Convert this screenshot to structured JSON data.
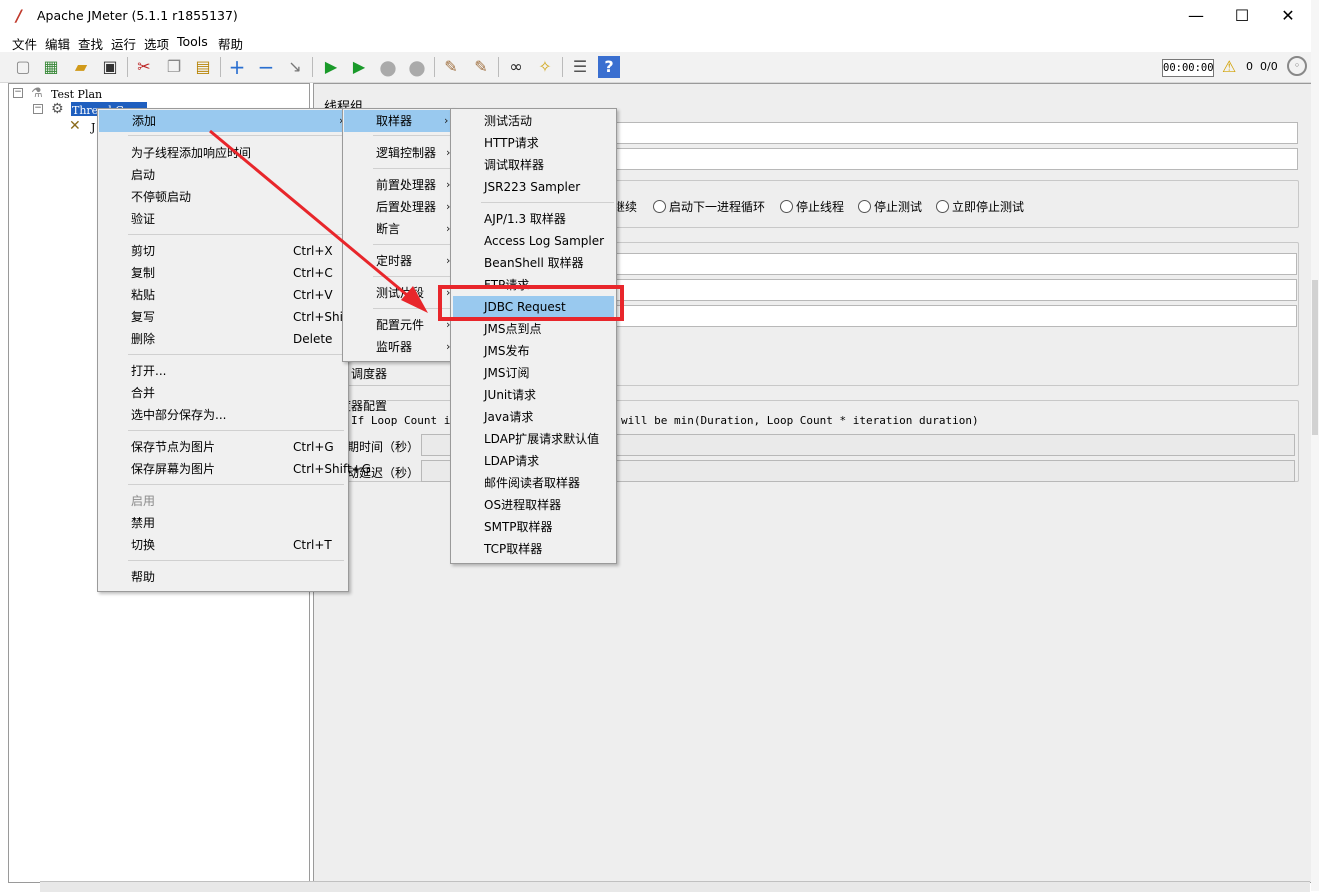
{
  "window": {
    "title": "Apache JMeter (5.1.1 r1855137)",
    "controls": {
      "minimize": "—",
      "maximize": "☐",
      "close": "✕"
    }
  },
  "menubar": [
    "文件",
    "编辑",
    "查找",
    "运行",
    "选项",
    "Tools",
    "帮助"
  ],
  "toolbar": {
    "timer": "00:00:00",
    "warning_count": "0",
    "thread_ratio": "0/0"
  },
  "tree": {
    "test_plan": "Test Plan",
    "thread_group": "Thread G",
    "child_partial": "J"
  },
  "right_panel": {
    "title": "线程组",
    "error_options": [
      "继续",
      "启动下一进程循环",
      "停止线程",
      "停止测试",
      "立即停止测试"
    ],
    "scheduler_checkbox": "调度器",
    "scheduler_section": "度器配置",
    "loop_note_left": "If Loop Count is",
    "loop_note_right": "will be min(Duration, Loop Count * iteration duration)",
    "duration_label": "期时间（秒）",
    "delay_label": "动延迟（秒）"
  },
  "context_menu": {
    "add": "添加",
    "items": [
      {
        "label": "为子线程添加响应时间",
        "shortcut": ""
      },
      {
        "label": "启动",
        "shortcut": ""
      },
      {
        "label": "不停顿启动",
        "shortcut": ""
      },
      {
        "label": "验证",
        "shortcut": ""
      },
      {
        "label": "剪切",
        "shortcut": "Ctrl+X"
      },
      {
        "label": "复制",
        "shortcut": "Ctrl+C"
      },
      {
        "label": "粘贴",
        "shortcut": "Ctrl+V"
      },
      {
        "label": "复写",
        "shortcut": "Ctrl+Shift+C"
      },
      {
        "label": "删除",
        "shortcut": "Delete"
      },
      {
        "label": "打开...",
        "shortcut": ""
      },
      {
        "label": "合并",
        "shortcut": ""
      },
      {
        "label": "选中部分保存为...",
        "shortcut": ""
      },
      {
        "label": "保存节点为图片",
        "shortcut": "Ctrl+G"
      },
      {
        "label": "保存屏幕为图片",
        "shortcut": "Ctrl+Shift+G"
      },
      {
        "label": "启用",
        "shortcut": ""
      },
      {
        "label": "禁用",
        "shortcut": ""
      },
      {
        "label": "切换",
        "shortcut": "Ctrl+T"
      },
      {
        "label": "帮助",
        "shortcut": ""
      }
    ]
  },
  "add_submenu": [
    "取样器",
    "逻辑控制器",
    "前置处理器",
    "后置处理器",
    "断言",
    "定时器",
    "测试片段",
    "配置元件",
    "监听器"
  ],
  "sampler_submenu": [
    "测试活动",
    "HTTP请求",
    "调试取样器",
    "JSR223 Sampler",
    "AJP/1.3 取样器",
    "Access Log Sampler",
    "BeanShell 取样器",
    "FTP请求",
    "JDBC Request",
    "JMS点到点",
    "JMS发布",
    "JMS订阅",
    "JUnit请求",
    "Java请求",
    "LDAP扩展请求默认值",
    "LDAP请求",
    "邮件阅读者取样器",
    "OS进程取样器",
    "SMTP取样器",
    "TCP取样器"
  ],
  "colors": {
    "highlight": "#99c9ef",
    "annotation_red": "#e8262b",
    "selection_blue": "#1f5fbf"
  }
}
